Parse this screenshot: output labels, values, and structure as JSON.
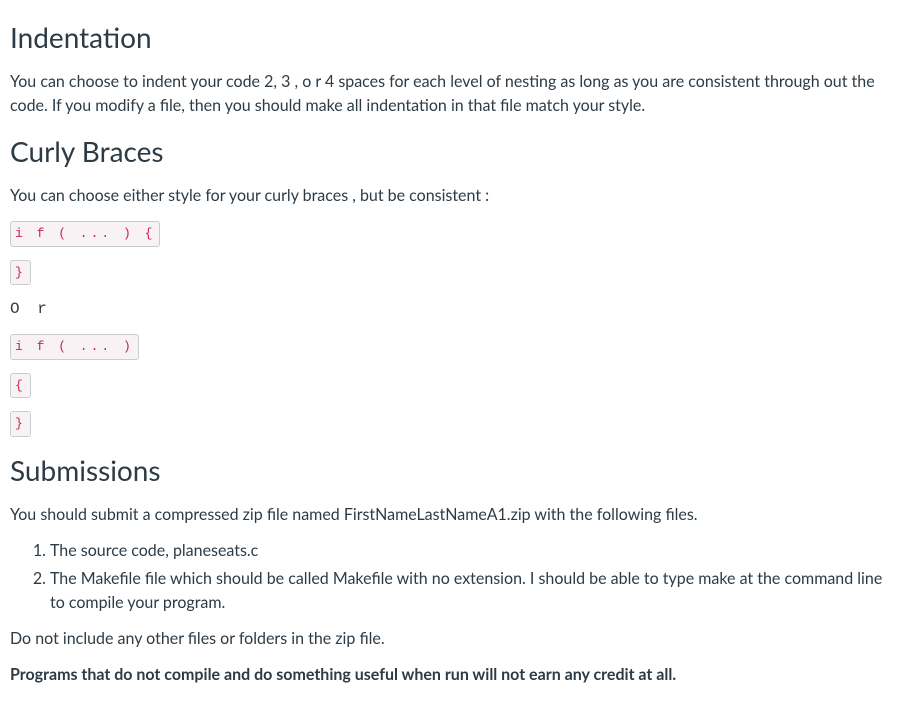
{
  "sections": {
    "indentation": {
      "heading": "Indentation",
      "body": "You can choose to indent your code 2, 3 , o r 4 spaces for each level of nesting as long as you are consistent through out the code. If you modify a file, then you should make all indentation in that file match your style."
    },
    "curly": {
      "heading": "Curly Braces",
      "intro": "You can choose either style for your curly braces , but be consistent :",
      "style1_line1": "i f ( ... ) {",
      "style1_line2": "}",
      "or_label": "O r",
      "style2_line1": "i f ( ... )",
      "style2_line2": "{",
      "style2_line3": "}"
    },
    "submissions": {
      "heading": "Submissions",
      "intro": "You should submit a compressed zip file named FirstNameLastNameA1.zip with the following files.",
      "items": [
        "The source code, planeseats.c",
        "The Makefile file which should be called Makefile with no extension.  I should be able to type make at the command line to compile your program."
      ],
      "note1": "Do not include any other files or folders in the zip file.",
      "note2": "Programs that do not compile and do something useful when run will not earn any credit at all."
    }
  }
}
